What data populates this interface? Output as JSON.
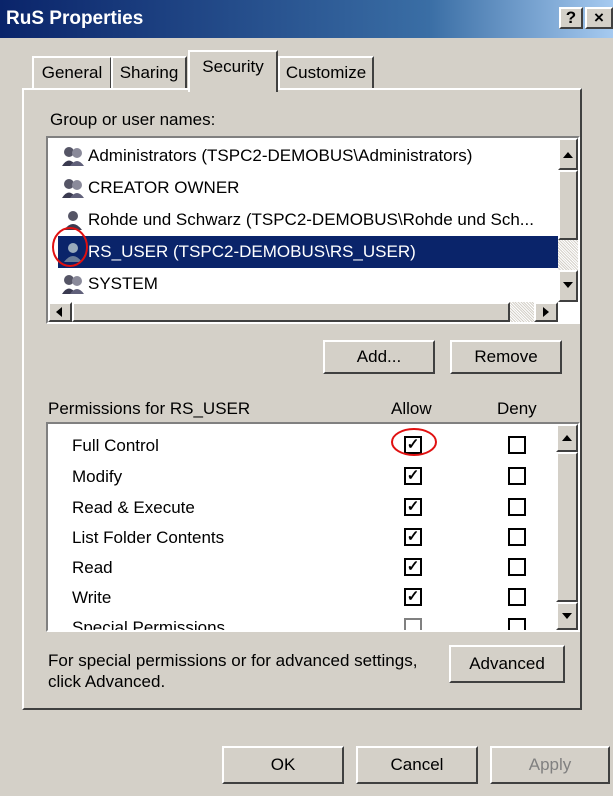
{
  "window": {
    "title": "RuS Properties",
    "help_button": "?",
    "close_button": "×"
  },
  "tabs": [
    {
      "label": "General"
    },
    {
      "label": "Sharing"
    },
    {
      "label": "Security"
    },
    {
      "label": "Customize"
    }
  ],
  "groups_label": "Group or user names:",
  "users": [
    {
      "name": "Administrators (TSPC2-DEMOBUS\\Administrators)"
    },
    {
      "name": "CREATOR OWNER"
    },
    {
      "name": "Rohde und Schwarz (TSPC2-DEMOBUS\\Rohde und Sch..."
    },
    {
      "name": "RS_USER (TSPC2-DEMOBUS\\RS_USER)"
    },
    {
      "name": "SYSTEM"
    }
  ],
  "add_button": "Add...",
  "remove_button": "Remove",
  "permissions_label": "Permissions for RS_USER",
  "allow_header": "Allow",
  "deny_header": "Deny",
  "permissions": [
    {
      "name": "Full Control",
      "allow": true,
      "deny": false
    },
    {
      "name": "Modify",
      "allow": true,
      "deny": false
    },
    {
      "name": "Read & Execute",
      "allow": true,
      "deny": false
    },
    {
      "name": "List Folder Contents",
      "allow": true,
      "deny": false
    },
    {
      "name": "Read",
      "allow": true,
      "deny": false
    },
    {
      "name": "Write",
      "allow": true,
      "deny": false
    },
    {
      "name": "Special Permissions",
      "allow": false,
      "deny": false
    }
  ],
  "advanced_text": "For special permissions or for advanced settings, click Advanced.",
  "advanced_button": "Advanced",
  "ok_button": "OK",
  "cancel_button": "Cancel",
  "apply_button": "Apply",
  "colors": {
    "titlebar": "#0a246a",
    "selection": "#0a246a",
    "annotation": "#e01010",
    "face": "#d4d0c8"
  }
}
